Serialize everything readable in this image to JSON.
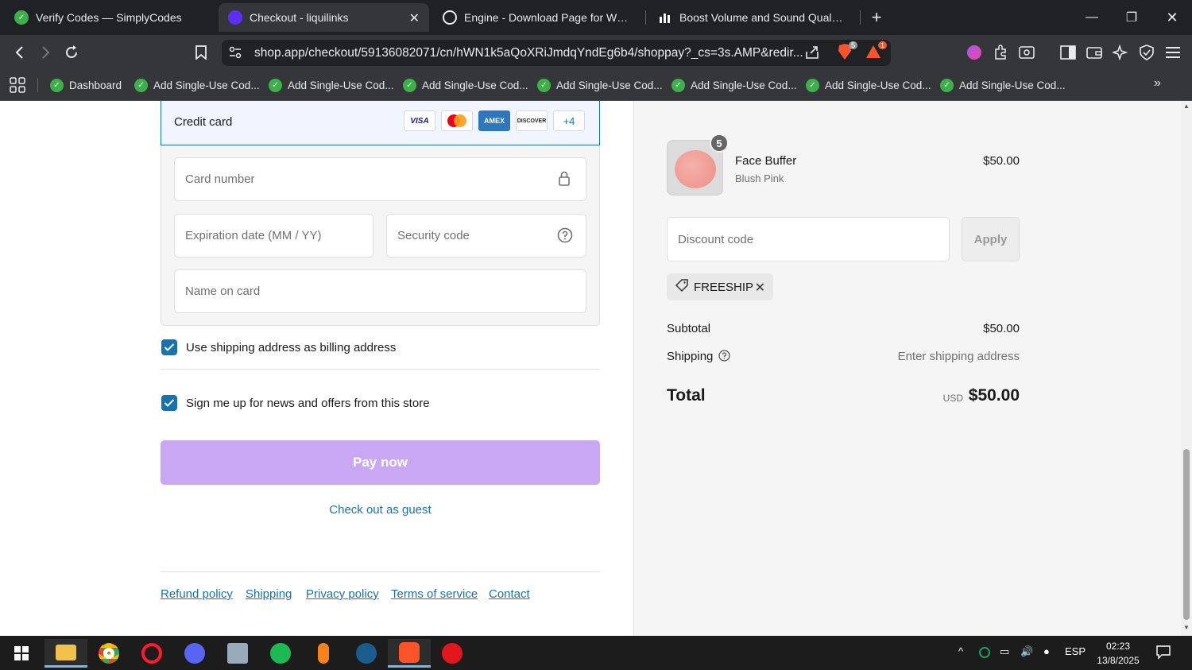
{
  "browser": {
    "tabs": [
      {
        "title": "Verify Codes — SimplyCodes",
        "active": false
      },
      {
        "title": "Checkout - liquilinks",
        "active": true
      },
      {
        "title": "Engine - Download Page for Window",
        "active": false
      },
      {
        "title": "Boost Volume and Sound Quality on",
        "active": false
      }
    ],
    "url": "shop.app/checkout/59136082071/cn/hWN1k5aQoXRiJmdqYndEg6b4/shoppay?_cs=3s.AMP&redir...",
    "brave_shield_count": "5",
    "rewards_count": "1",
    "bookmarks": [
      "Dashboard",
      "Add Single-Use Cod...",
      "Add Single-Use Cod...",
      "Add Single-Use Cod...",
      "Add Single-Use Cod...",
      "Add Single-Use Cod...",
      "Add Single-Use Cod...",
      "Add Single-Use Cod..."
    ]
  },
  "payment": {
    "method_label": "Credit card",
    "card_brands": [
      "VISA",
      "",
      "AMEX",
      "DISCOVER"
    ],
    "more_brands": "+4",
    "card_number_placeholder": "Card number",
    "expiration_placeholder": "Expiration date (MM / YY)",
    "security_placeholder": "Security code",
    "name_placeholder": "Name on card"
  },
  "options": {
    "billing_same": "Use shipping address as billing address",
    "newsletter": "Sign me up for news and offers from this store"
  },
  "actions": {
    "pay_now": "Pay now",
    "guest": "Check out as guest"
  },
  "footer": {
    "links": [
      "Refund policy",
      "Shipping",
      "Privacy policy",
      "Terms of service",
      "Contact"
    ]
  },
  "order": {
    "item": {
      "quantity": "5",
      "name": "Face Buffer",
      "variant": "Blush Pink",
      "price": "$50.00"
    },
    "discount_placeholder": "Discount code",
    "apply_label": "Apply",
    "applied_code": "FREESHIP",
    "subtotal_label": "Subtotal",
    "subtotal_value": "$50.00",
    "shipping_label": "Shipping",
    "shipping_value": "Enter shipping address",
    "total_label": "Total",
    "total_currency": "USD",
    "total_value": "$50.00"
  },
  "taskbar": {
    "language": "ESP",
    "time": "02:23",
    "date": "13/8/2025"
  },
  "colors": {
    "accent": "#1773b0",
    "pay_button": "#c9a7f2",
    "browser_dark": "#202124"
  }
}
